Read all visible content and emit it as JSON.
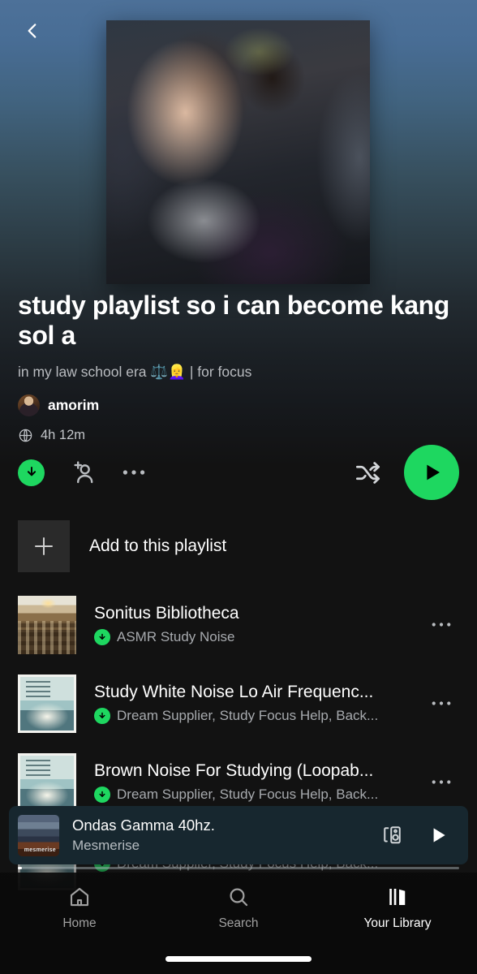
{
  "header": {
    "back_icon": "chevron-left-icon",
    "cover_alt": "playlist-cover-art"
  },
  "playlist": {
    "title": "study playlist so i can become kang sol a",
    "description": "in my law school era ⚖️👱‍♀️ | for focus",
    "owner": "amorim",
    "visibility_icon": "globe-icon",
    "duration": "4h 12m"
  },
  "actions": {
    "download_label": "Download",
    "add_people_label": "Add people",
    "more_label": "More options",
    "shuffle_label": "Shuffle",
    "play_label": "Play"
  },
  "add_row": {
    "label": "Add to this playlist",
    "icon": "plus-icon"
  },
  "tracks": [
    {
      "title": "Sonitus Bibliotheca",
      "artist": "ASMR Study Noise",
      "downloaded": true,
      "art": "library",
      "more_label": "More options"
    },
    {
      "title": "Study White Noise Lo Air Frequenc...",
      "artist": "Dream Supplier, Study Focus Help, Back...",
      "downloaded": true,
      "art": "book",
      "more_label": "More options"
    },
    {
      "title": "Brown Noise For Studying (Loopab...",
      "artist": "Dream Supplier, Study Focus Help, Back...",
      "downloaded": true,
      "art": "book",
      "more_label": "More options"
    },
    {
      "title": "",
      "artist": "Dream Supplier, Study Focus Help, Back...",
      "downloaded": true,
      "art": "book",
      "more_label": "More options"
    }
  ],
  "now_playing": {
    "title": "Ondas Gamma 40hz.",
    "artist": "Mesmerise",
    "thumb_caption": "mesmerise",
    "connect_icon": "spotify-connect-icon",
    "play_icon": "play-icon",
    "progress_percent": 1
  },
  "nav": [
    {
      "label": "Home",
      "icon": "home-icon",
      "active": false
    },
    {
      "label": "Search",
      "icon": "search-icon",
      "active": false
    },
    {
      "label": "Your Library",
      "icon": "library-icon",
      "active": true
    }
  ],
  "colors": {
    "accent_green": "#1ed760",
    "background": "#121212",
    "nowplaying_bg": "#17272f",
    "gradient_top": "#4d7199"
  }
}
